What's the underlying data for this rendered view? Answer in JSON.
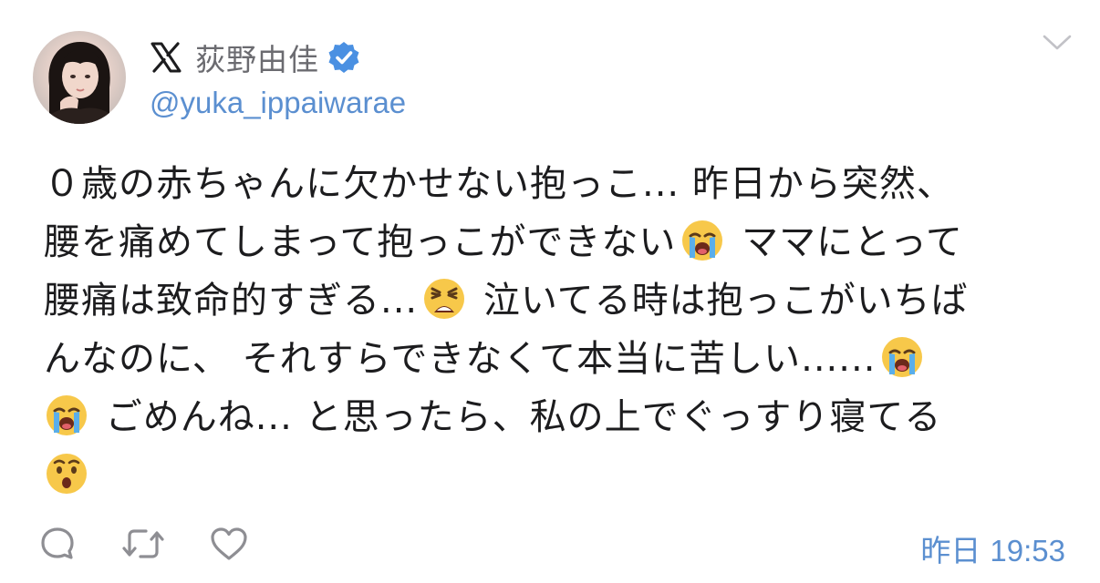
{
  "user": {
    "display_name": "荻野由佳",
    "handle": "@yuka_ippaiwarae",
    "verified": true,
    "platform_icon": "x-logo-icon"
  },
  "tweet": {
    "lines": [
      "０歳の赤ちゃんに欠かせない抱っこ... 昨日から突然、",
      "腰を痛めてしまって抱っこができない",
      " ママにとって",
      "腰痛は致命的すぎる...",
      " 泣いてる時は抱っこがいちば",
      "んなのに、 それすらできなくて本当に苦しい......",
      " ごめんね... と思ったら、私の上でぐっすり寝てる"
    ],
    "emojis": {
      "crying": "loudly-crying-face-emoji",
      "weary": "weary-face-emoji",
      "surprised": "hushed-face-emoji"
    }
  },
  "footer": {
    "day": "昨日",
    "time": "19:53",
    "actions": [
      "reply-icon",
      "retweet-icon",
      "like-icon"
    ]
  },
  "colors": {
    "link_blue": "#5b8fd0",
    "verified_blue": "#4a90e2",
    "text": "#1c1c1e",
    "muted": "#6b6b70",
    "icon_gray": "#8e8e93"
  }
}
